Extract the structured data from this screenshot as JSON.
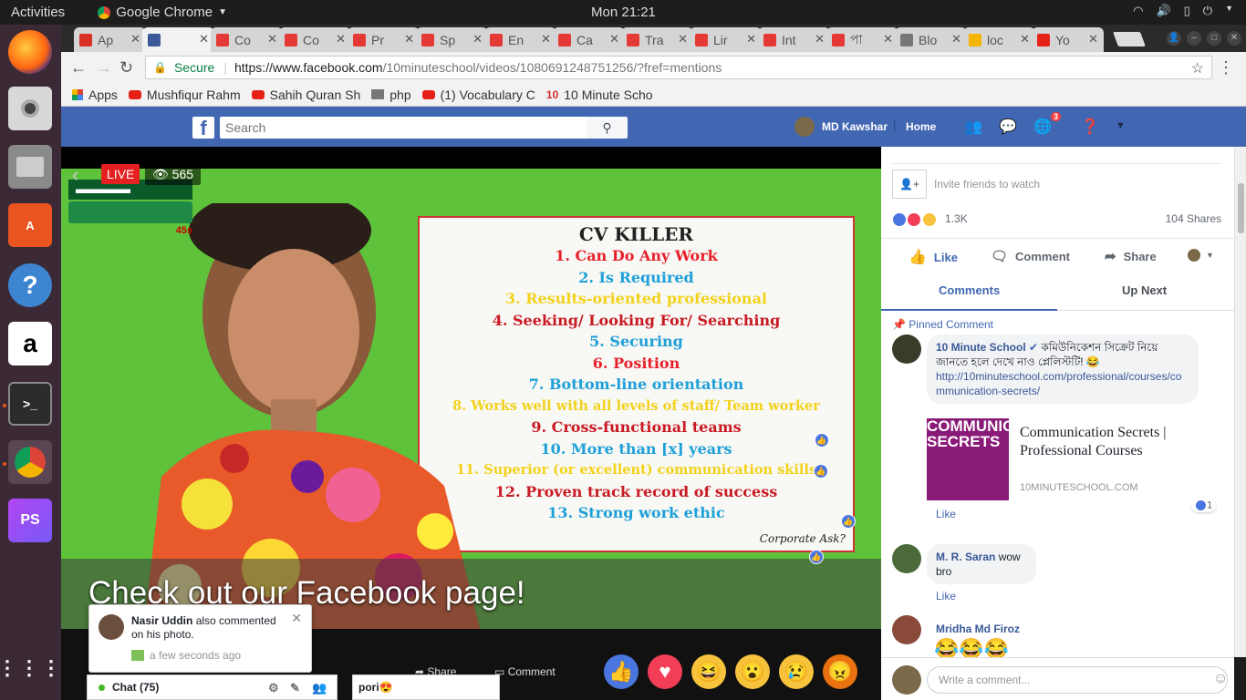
{
  "topbar": {
    "activities": "Activities",
    "app": "Google Chrome",
    "clock": "Mon 21:21"
  },
  "dock": [
    "firefox-icon",
    "speaker-icon",
    "files-icon",
    "software-center-icon",
    "help-icon",
    "amazon-icon",
    "terminal-icon",
    "chrome-icon",
    "phpstorm-icon",
    "app-grid-icon"
  ],
  "tabs": [
    {
      "label": "Ap",
      "color": "#d93025"
    },
    {
      "label": "",
      "color": "#3b5998"
    },
    {
      "label": "Co",
      "color": "#e53935"
    },
    {
      "label": "Co",
      "color": "#e53935"
    },
    {
      "label": "Pr",
      "color": "#e53935"
    },
    {
      "label": "Sp",
      "color": "#e53935"
    },
    {
      "label": "En",
      "color": "#e53935"
    },
    {
      "label": "Ca",
      "color": "#e53935"
    },
    {
      "label": "Tra",
      "color": "#e53935"
    },
    {
      "label": "Lir",
      "color": "#e53935"
    },
    {
      "label": "Int",
      "color": "#e53935"
    },
    {
      "label": "পা",
      "color": "#e53935"
    },
    {
      "label": "Blo",
      "color": "#777777"
    },
    {
      "label": "loc",
      "color": "#f4b400"
    },
    {
      "label": "Yo",
      "color": "#e62117"
    }
  ],
  "address": {
    "secure": "Secure",
    "host": "https://www.facebook.com",
    "path": "/10minuteschool/videos/1080691248751256/?fref=mentions"
  },
  "bookmarks": {
    "apps": "Apps",
    "items": [
      "Mushfiqur Rahm",
      "Sahih Quran Sh",
      "php",
      "(1) Vocabulary C",
      "10 Minute Scho"
    ]
  },
  "fb": {
    "search_placeholder": "Search",
    "user": "MD Kawshar",
    "home": "Home",
    "notif_count": "3"
  },
  "video": {
    "live": "LIVE",
    "viewers": "565",
    "caption": "Check out our Facebook page!",
    "board_title": "CV KILLER",
    "board_items": [
      {
        "text": "1. Can Do Any Work",
        "color": "#e8202b"
      },
      {
        "text": "2. Is Required",
        "color": "#1ea0d8"
      },
      {
        "text": "3. Results-oriented professional",
        "color": "#f2d21b"
      },
      {
        "text": "4. Seeking/ Looking For/ Searching",
        "color": "#c91a24"
      },
      {
        "text": "5. Securing",
        "color": "#1ea0d8"
      },
      {
        "text": "6. Position",
        "color": "#e8202b"
      },
      {
        "text": "7. Bottom-line orientation",
        "color": "#1ea0d8"
      },
      {
        "text": "8. Works well with all levels of staff/ Team worker",
        "color": "#f2d21b"
      },
      {
        "text": "9. Cross-functional teams",
        "color": "#c91a24"
      },
      {
        "text": "10. More than [x] years",
        "color": "#1ea0d8"
      },
      {
        "text": "11. Superior (or excellent) communication skills",
        "color": "#f2d21b"
      },
      {
        "text": "12. Proven track record of success",
        "color": "#c91a24"
      },
      {
        "text": "13. Strong work ethic",
        "color": "#1ea0d8"
      }
    ],
    "board_brand": "Corporate Ask?",
    "share": "Share",
    "comment": "Comment"
  },
  "notification": {
    "name": "Nasir Uddin",
    "text": "also commented on his photo.",
    "time": "a few seconds ago"
  },
  "chat": {
    "label": "Chat (75)",
    "open_chat": "pori😍"
  },
  "panel": {
    "invite": "Invite friends to watch",
    "reaction_count": "1.3K",
    "shares": "104 Shares",
    "like": "Like",
    "comment": "Comment",
    "share": "Share",
    "tab_comments": "Comments",
    "tab_upnext": "Up Next",
    "pinned": "Pinned Comment",
    "comments": [
      {
        "name": "10 Minute School",
        "text": "কমিউনিকেশন সিক্রেট নিয়ে জানতে হলে দেখে নাও প্লেলিস্টটি! 😂",
        "link": "http://10minuteschool.com/professional/courses/communication-secrets/"
      },
      {
        "name": "M. R. Saran",
        "text": "wow bro"
      },
      {
        "name": "Mridha Md Firoz",
        "text": "😂😂😂"
      }
    ],
    "link_card": {
      "title": "Communication Secrets | Professional Courses",
      "domain": "10MINUTESCHOOL.COM",
      "image_text": "COMMUNICATIO SECRETS"
    },
    "like_link": "Like",
    "like_count": "1",
    "write_placeholder": "Write a comment..."
  }
}
